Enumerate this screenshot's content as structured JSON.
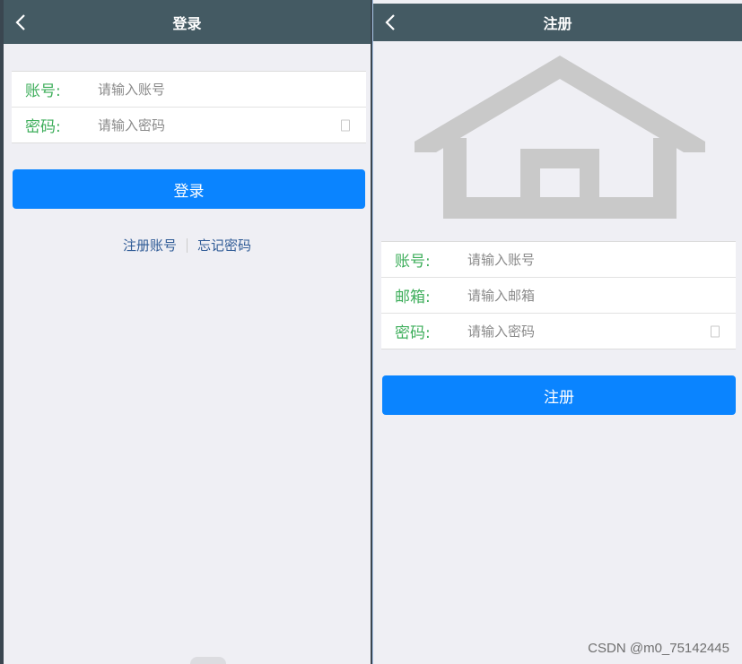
{
  "login": {
    "title": "登录",
    "account_label": "账号:",
    "account_placeholder": "请输入账号",
    "password_label": "密码:",
    "password_placeholder": "请输入密码",
    "login_button": "登录",
    "register_link": "注册账号",
    "forgot_link": "忘记密码"
  },
  "register": {
    "title": "注册",
    "account_label": "账号:",
    "account_placeholder": "请输入账号",
    "email_label": "邮箱:",
    "email_placeholder": "请输入邮箱",
    "password_label": "密码:",
    "password_placeholder": "请输入密码",
    "register_button": "注册"
  },
  "watermark": "CSDN @m0_75142445",
  "colors": {
    "header_bg": "#445a63",
    "page_bg": "#efeff4",
    "primary": "#0a84ff",
    "label_green": "#3eae5b",
    "link_blue": "#2f5b96"
  },
  "icons": {
    "back": "chevron-left-icon",
    "eye": "eye-toggle-icon",
    "logo": "house-icon"
  }
}
